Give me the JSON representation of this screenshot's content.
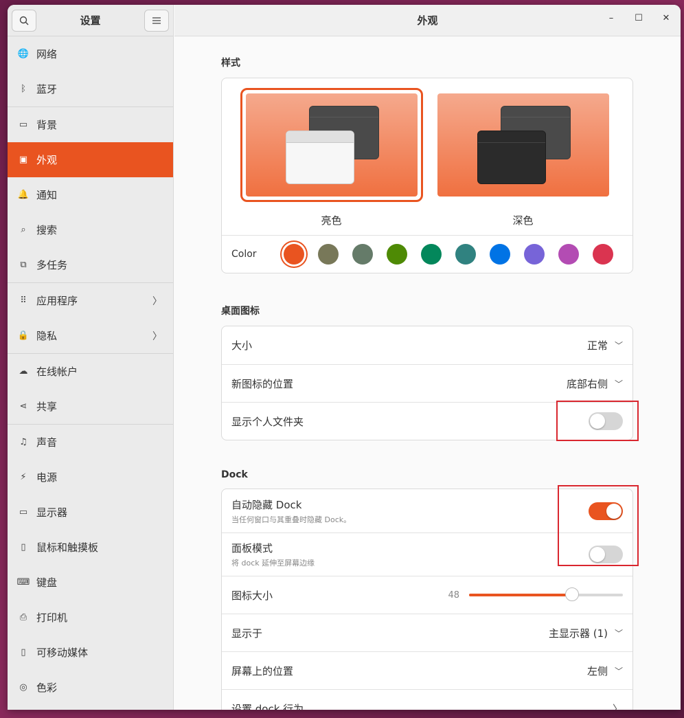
{
  "sidebar": {
    "title": "设置",
    "items": [
      {
        "label": "网络",
        "icon": "globe-icon",
        "glyph": "🌐"
      },
      {
        "label": "蓝牙",
        "icon": "bluetooth-icon",
        "glyph": "ᛒ"
      },
      {
        "label": "背景",
        "icon": "monitor-icon",
        "glyph": "▭"
      },
      {
        "label": "外观",
        "icon": "appearance-icon",
        "glyph": "▣"
      },
      {
        "label": "通知",
        "icon": "bell-icon",
        "glyph": "🔔"
      },
      {
        "label": "搜索",
        "icon": "search-icon",
        "glyph": "⌕"
      },
      {
        "label": "多任务",
        "icon": "multitask-icon",
        "glyph": "⧉"
      },
      {
        "label": "应用程序",
        "icon": "grid-icon",
        "glyph": "⠿"
      },
      {
        "label": "隐私",
        "icon": "lock-icon",
        "glyph": "🔒"
      },
      {
        "label": "在线帐户",
        "icon": "cloud-icon",
        "glyph": "☁"
      },
      {
        "label": "共享",
        "icon": "share-icon",
        "glyph": "⋖"
      },
      {
        "label": "声音",
        "icon": "music-note-icon",
        "glyph": "♫"
      },
      {
        "label": "电源",
        "icon": "power-icon",
        "glyph": "⚡"
      },
      {
        "label": "显示器",
        "icon": "display-icon",
        "glyph": "▭"
      },
      {
        "label": "鼠标和触摸板",
        "icon": "mouse-icon",
        "glyph": "▯"
      },
      {
        "label": "键盘",
        "icon": "keyboard-icon",
        "glyph": "⌨"
      },
      {
        "label": "打印机",
        "icon": "printer-icon",
        "glyph": "⎙"
      },
      {
        "label": "可移动媒体",
        "icon": "usb-icon",
        "glyph": "▯"
      },
      {
        "label": "色彩",
        "icon": "color-icon",
        "glyph": "◎"
      }
    ]
  },
  "main": {
    "title": "外观",
    "style_section": {
      "title": "样式",
      "themes": [
        {
          "label": "亮色",
          "selected": true
        },
        {
          "label": "深色",
          "selected": false
        }
      ],
      "color_label": "Color",
      "colors": [
        "#e95420",
        "#787859",
        "#657b69",
        "#4e8a05",
        "#03875b",
        "#308280",
        "#0073e5",
        "#7764d8",
        "#b34cb3",
        "#da3450"
      ],
      "selected_color": "#e95420"
    },
    "desktop_icons": {
      "title": "桌面图标",
      "size_label": "大小",
      "size_value": "正常",
      "position_label": "新图标的位置",
      "position_value": "底部右侧",
      "show_home_label": "显示个人文件夹",
      "show_home": false
    },
    "dock": {
      "title": "Dock",
      "autohide_label": "自动隐藏 Dock",
      "autohide_sub": "当任何窗口与其重叠时隐藏 Dock。",
      "autohide": true,
      "panel_label": "面板模式",
      "panel_sub": "将 dock 延伸至屏幕边缘",
      "panel": false,
      "icon_size_label": "图标大小",
      "icon_size_value": "48",
      "icon_size_fraction": 0.67,
      "show_on_label": "显示于",
      "show_on_value": "主显示器 (1)",
      "position_label": "屏幕上的位置",
      "position_value": "左侧",
      "behavior_label": "设置 dock 行为"
    }
  }
}
